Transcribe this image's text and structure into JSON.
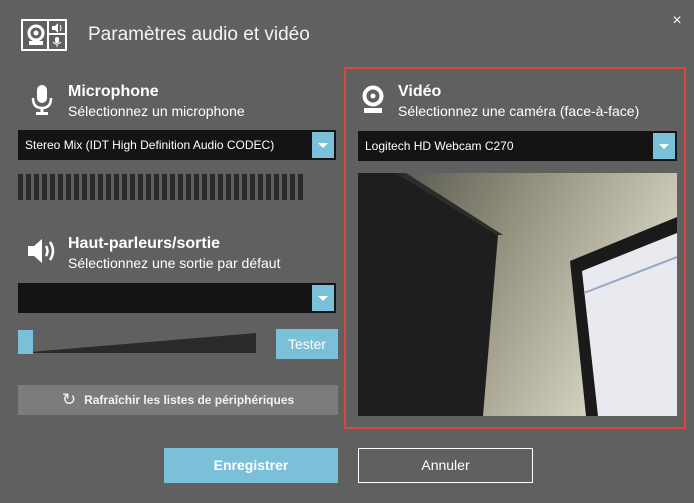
{
  "header": {
    "title": "Paramètres audio et vidéo",
    "close_glyph": "×",
    "logo_icon": "settings-logo-icon"
  },
  "microphone": {
    "title": "Microphone",
    "subtitle": "Sélectionnez un microphone",
    "icon": "microphone-icon",
    "selected_device": "Stereo Mix (IDT High Definition Audio CODEC)",
    "level_bar_count": 36,
    "level": 0
  },
  "speakers": {
    "title": "Haut-parleurs/sortie",
    "subtitle": "Sélectionnez une sortie par défaut",
    "icon": "speaker-icon",
    "selected_device": "",
    "volume": 0,
    "test_label": "Tester"
  },
  "video": {
    "title": "Vidéo",
    "subtitle": "Sélectionnez une caméra (face-à-face)",
    "icon": "webcam-icon",
    "selected_device": "Logitech HD Webcam C270"
  },
  "refresh": {
    "label": "Rafraîchir les listes de périphériques",
    "icon_glyph": "↻"
  },
  "footer": {
    "save_label": "Enregistrer",
    "cancel_label": "Annuler"
  },
  "colors": {
    "background": "#606060",
    "accent": "#79c0d8",
    "highlight_border": "#d9473a",
    "dropdown_bg": "#141414",
    "secondary_button": "#7c7c7c"
  }
}
